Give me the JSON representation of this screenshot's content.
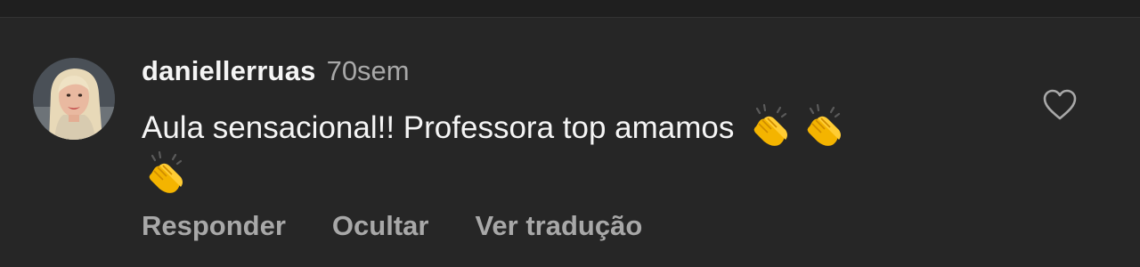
{
  "comment": {
    "username": "daniellerruas",
    "timestamp": "70sem",
    "text": "Aula sensacional!! Professora top amamos",
    "emojis": [
      "clapping-hands",
      "clapping-hands",
      "clapping-hands"
    ]
  },
  "actions": {
    "reply_label": "Responder",
    "hide_label": "Ocultar",
    "translate_label": "Ver tradução"
  },
  "colors": {
    "background": "#262626",
    "primary_text": "#f5f5f5",
    "secondary_text": "#a8a8a8"
  }
}
